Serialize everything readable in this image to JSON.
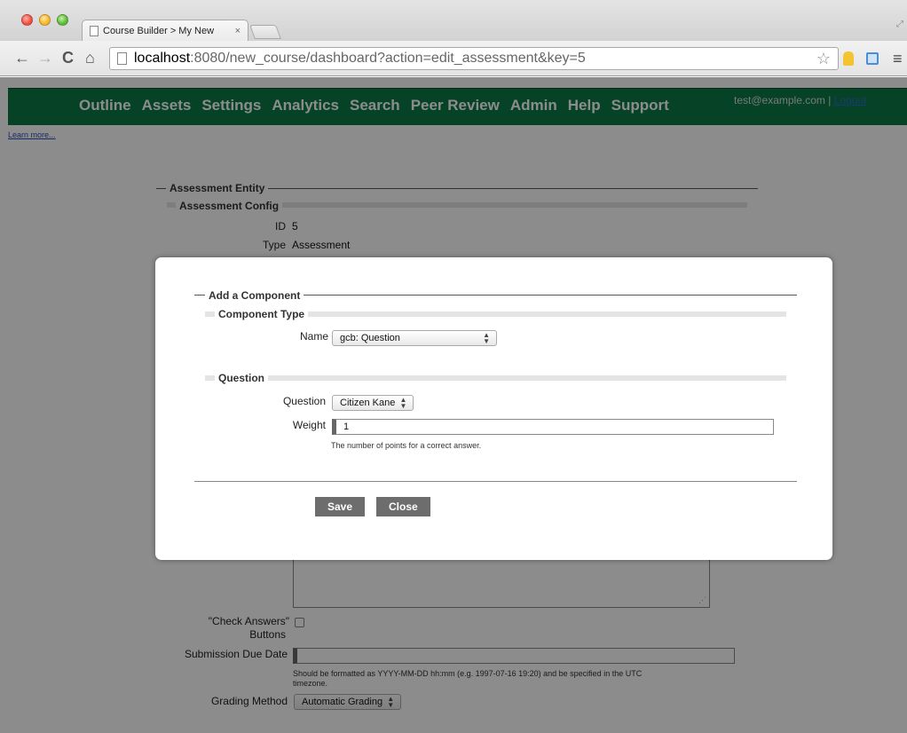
{
  "browser": {
    "tab_title": "Course Builder > My New",
    "tab_close": "×",
    "url_host": "localhost",
    "url_rest": ":8080/new_course/dashboard?action=edit_assessment&key=5"
  },
  "nav": {
    "items": [
      "Outline",
      "Assets",
      "Settings",
      "Analytics",
      "Search",
      "Peer Review",
      "Admin",
      "Help",
      "Support"
    ],
    "user_email": "test@example.com",
    "separator": "|",
    "logout": "Logout"
  },
  "page": {
    "learn_more": "Learn more...",
    "entity_legend": "Assessment Entity",
    "config_legend": "Assessment Config",
    "id_label": "ID",
    "id_value": "5",
    "type_label": "Type",
    "type_value": "Assessment",
    "check_answers_label_1": "\"Check Answers\"",
    "check_answers_label_2": "Buttons",
    "due_date_label": "Submission Due Date",
    "due_date_value": "",
    "due_date_help_1": "Should be formatted as YYYY-MM-DD hh:mm (e.g. 1997-07-16 19:20) and be specified in the UTC",
    "due_date_help_2": "timezone.",
    "grading_label": "Grading Method",
    "grading_value": "Automatic Grading"
  },
  "modal": {
    "legend": "Add a Component",
    "component_type_legend": "Component Type",
    "name_label": "Name",
    "name_value": "gcb: Question",
    "question_legend": "Question",
    "question_label": "Question",
    "question_value": "Citizen Kane",
    "weight_label": "Weight",
    "weight_value": "1",
    "weight_help": "The number of points for a correct answer.",
    "save_label": "Save",
    "close_label": "Close"
  },
  "colors": {
    "navbar": "#0b7a45",
    "button": "#6d6d6d",
    "link": "#2a6cd6"
  }
}
